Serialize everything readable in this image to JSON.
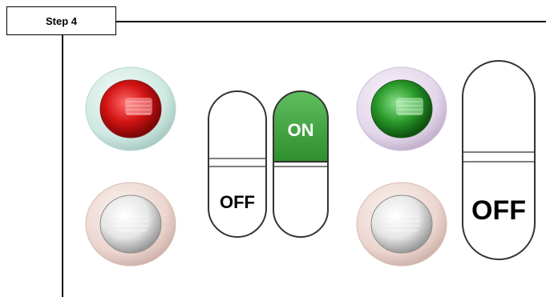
{
  "step_label": "Step 4",
  "switches": {
    "pair_left_top": "",
    "pair_left_bottom": "OFF",
    "pair_right_top": "ON",
    "single_bottom": "OFF"
  },
  "colors": {
    "lamp_red": "#d41414",
    "lamp_green": "#2a9a2a",
    "switch_on_green": "#3fa33f",
    "ring_teal": "#cfe8e2",
    "ring_lavender": "#e3d7ea",
    "ring_pink": "#ecd6cf"
  }
}
